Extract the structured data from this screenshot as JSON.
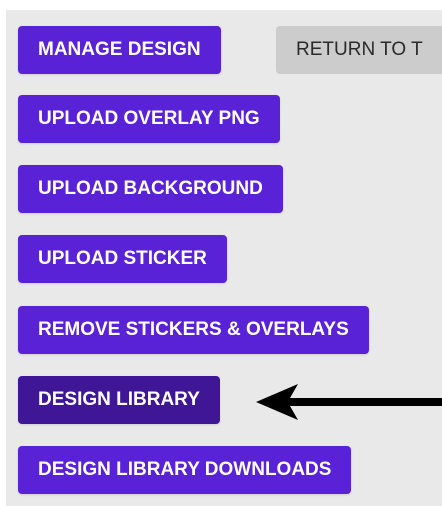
{
  "toolbar": {
    "manage_design": "MANAGE DESIGN",
    "return_to": "RETURN TO T",
    "upload_overlay": "UPLOAD OVERLAY PNG",
    "upload_background": "UPLOAD BACKGROUND",
    "upload_sticker": "UPLOAD STICKER",
    "remove_stickers_overlays": "REMOVE STICKERS & OVERLAYS",
    "design_library": "DESIGN LIBRARY",
    "design_library_downloads": "DESIGN LIBRARY DOWNLOADS"
  },
  "annotation": {
    "arrow_icon": "left-arrow-icon",
    "target": "design-library-button"
  },
  "colors": {
    "primary": "#5a22d6",
    "active": "#3f1696",
    "secondary": "#cccccc",
    "panel": "#e9e9e9"
  }
}
